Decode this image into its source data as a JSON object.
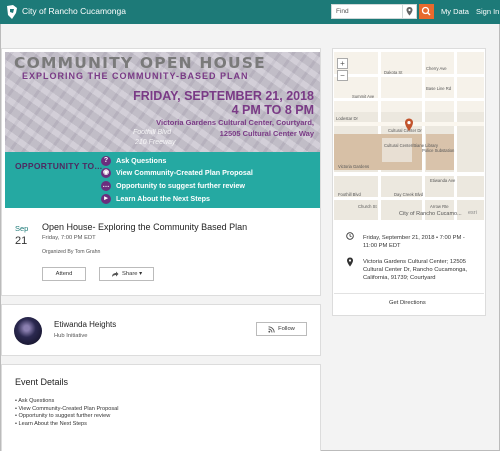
{
  "topnav": {
    "site_title": "City of Rancho Cucamonga",
    "search_placeholder": "Find",
    "my_data": "My Data",
    "sign_in": "Sign In"
  },
  "banner": {
    "title": "COMMUNITY OPEN HOUSE",
    "subtitle": "EXPLORING THE COMMUNITY-BASED PLAN",
    "date": "FRIDAY, SEPTEMBER 21, 2018",
    "time": "4 PM TO 8 PM",
    "location_line1": "Victoria Gardens Cultural Center, Courtyard,",
    "location_line2": "12505 Cultural Center Way",
    "road_label1": "Foothill Blvd",
    "road_label2": "210 Freeway",
    "opportunity_heading": "OPPORTUNITY TO...",
    "opportunities": [
      "Ask Questions",
      "View Community-Created Plan Proposal",
      "Opportunity to suggest further review",
      "Learn About the Next Steps"
    ]
  },
  "event": {
    "month": "Sep",
    "day": "21",
    "title": "Open House- Exploring the Community Based Plan",
    "time": "Friday, 7:00 PM EDT",
    "organizer": "Organized By Tom Grahn",
    "attend_label": "Attend",
    "share_label": "Share ▾"
  },
  "map": {
    "attribution": "City of Rancho Cucamo...",
    "esri": "esri",
    "zoom_in": "+",
    "zoom_out": "−",
    "labels": {
      "dakota": "Dakota St",
      "cherry": "Cherry Ave",
      "summit": "Summit Ave",
      "etiwanda": "Etiwanda Ave",
      "cultural_center": "Cultural Center Dr",
      "library": "Cultural Center/Biane Library",
      "police": "Police Substation",
      "victoria": "Victoria Gardens",
      "foothill": "Foothill Blvd",
      "arrow": "Arrow Rte",
      "church": "Church St",
      "day_creek": "Day Creek Blvd",
      "baseline": "Base Line Rd",
      "lodestar": "Lodestar Dr"
    }
  },
  "event_info": {
    "datetime": "Friday, September 21, 2018 • 7:00 PM - 11:00 PM EDT",
    "address": "Victoria Gardens Cultural Center; 12505 Cultural Center Dr, Rancho Cucamonga, California, 91739; Courtyard",
    "directions_label": "Get Directions"
  },
  "hub": {
    "name": "Etiwanda Heights",
    "subtitle": "Hub Initiative",
    "follow_label": "Follow"
  },
  "details": {
    "title": "Event Details",
    "items": [
      "• Ask Questions",
      "• View Community-Created Plan Proposal",
      "• Opportunity to suggest further review",
      "• Learn About the Next Steps"
    ]
  },
  "colors": {
    "nav_teal": "#1d7a78",
    "banner_teal": "#25a9a2",
    "banner_purple": "#7a3a86",
    "search_orange": "#e86a2d",
    "map_marker": "#c2542d"
  }
}
